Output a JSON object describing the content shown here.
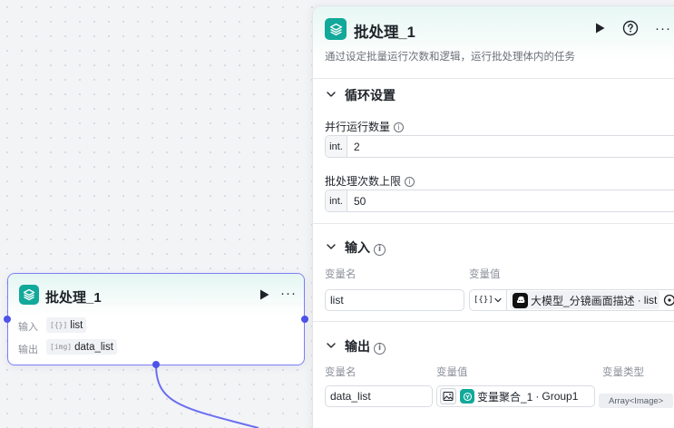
{
  "canvas_node": {
    "title": "批处理_1",
    "input_label": "输入",
    "input_type": "[{}]",
    "input_value": "list",
    "output_label": "输出",
    "output_type": "[img]",
    "output_value": "data_list"
  },
  "panel": {
    "title": "批处理_1",
    "description": "通过设定批量运行次数和逻辑，运行批处理体内的任务",
    "loop_section": {
      "title": "循环设置",
      "parallel_label": "并行运行数量",
      "parallel_prefix": "int.",
      "parallel_value": "2",
      "limit_label": "批处理次数上限",
      "limit_prefix": "int.",
      "limit_value": "50"
    },
    "input_section": {
      "title": "输入",
      "col_name": "变量名",
      "col_value": "变量值",
      "var_name": "list",
      "type_label": "[{}]",
      "ref_node": "大模型_分镜画面描述",
      "ref_sep": "·",
      "ref_field": "list"
    },
    "output_section": {
      "title": "输出",
      "col_name": "变量名",
      "col_value": "变量值",
      "col_type": "变量类型",
      "var_name": "data_list",
      "ref_node": "变量聚合_1",
      "ref_sep": "·",
      "ref_field": "Group1",
      "var_type": "Array<Image>"
    }
  },
  "colors": {
    "accent": "#4d53e8",
    "node_border": "#7b7ff5",
    "teal": "#12a99b"
  }
}
